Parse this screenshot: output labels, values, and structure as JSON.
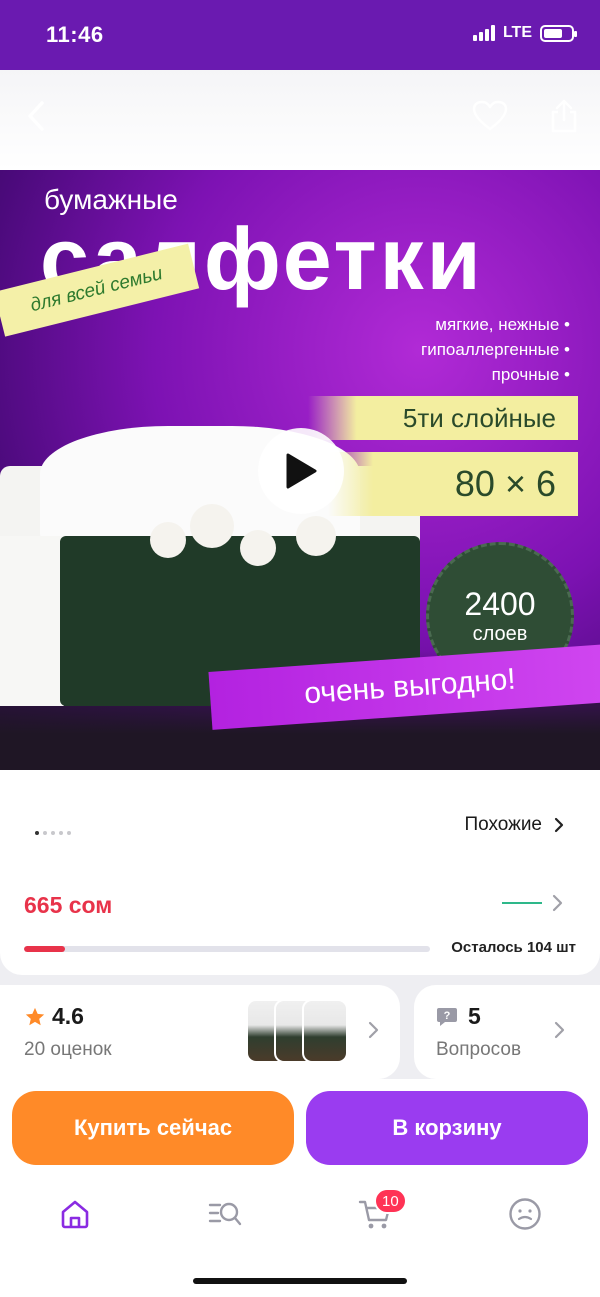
{
  "status_bar": {
    "time": "11:46",
    "network": "LTE"
  },
  "hero": {
    "subtitle": "бумажные",
    "title": "салфетки",
    "family_ribbon": "для всей семьи",
    "features": [
      "мягкие, нежные",
      "гипоаллергенные",
      "прочные"
    ],
    "layers_label": "5ти слойные",
    "pack_label": "80 × 6",
    "seal_number": "2400",
    "seal_unit": "слоев",
    "promo_label": "очень выгодно!"
  },
  "gallery": {
    "image_count": 5,
    "active_index": 0
  },
  "similar_label": "Похожие",
  "price": "665 сом",
  "stock": {
    "label": "Осталось 104 шт",
    "fill_percent": 10
  },
  "rating": {
    "value": "4.6",
    "count_label": "20 оценок"
  },
  "questions": {
    "count": "5",
    "label": "Вопросов"
  },
  "buttons": {
    "buy_now": "Купить сейчас",
    "add_to_cart": "В корзину"
  },
  "tabbar": {
    "cart_badge": "10"
  },
  "colors": {
    "brand": "#6a1ab0",
    "price": "#e8334a",
    "buy": "#ff8a28",
    "cart": "#9a3cf0"
  },
  "icons": [
    "back-icon",
    "heart-icon",
    "share-icon",
    "play-icon",
    "star-icon",
    "question-icon",
    "home-icon",
    "search-icon",
    "cart-icon",
    "profile-icon"
  ]
}
